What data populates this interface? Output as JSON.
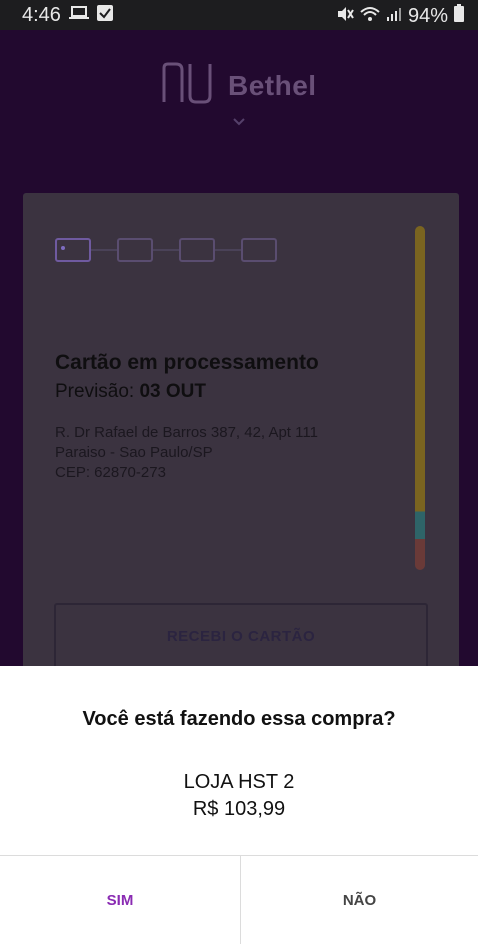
{
  "status_bar": {
    "time": "4:46",
    "battery": "94%",
    "icons": [
      "laptop-icon",
      "check-notification-icon",
      "mute-icon",
      "wifi-icon",
      "signal-icon",
      "battery-icon"
    ]
  },
  "header": {
    "brand": "Bethel",
    "logo_icon": "nu-logo-icon",
    "chevron_icon": "chevron-down-icon"
  },
  "card": {
    "title": "Cartão em processamento",
    "forecast_label": "Previsão:",
    "forecast_date": "03 OUT",
    "address_line1": "R. Dr Rafael de Barros 387, 42, Apt 111",
    "address_line2": "Paraiso - Sao Paulo/SP",
    "address_line3": "CEP: 62870-273",
    "received_button": "RECEBI O CARTÃO",
    "steps_count": 4,
    "active_step": 1
  },
  "dialog": {
    "question": "Você está fazendo essa compra?",
    "merchant": "LOJA HST 2",
    "amount": "R$ 103,99",
    "yes_label": "SIM",
    "no_label": "NÃO"
  },
  "colors": {
    "background": "#22092f",
    "accent": "#8a2bb3",
    "sheet": "#ffffff"
  }
}
